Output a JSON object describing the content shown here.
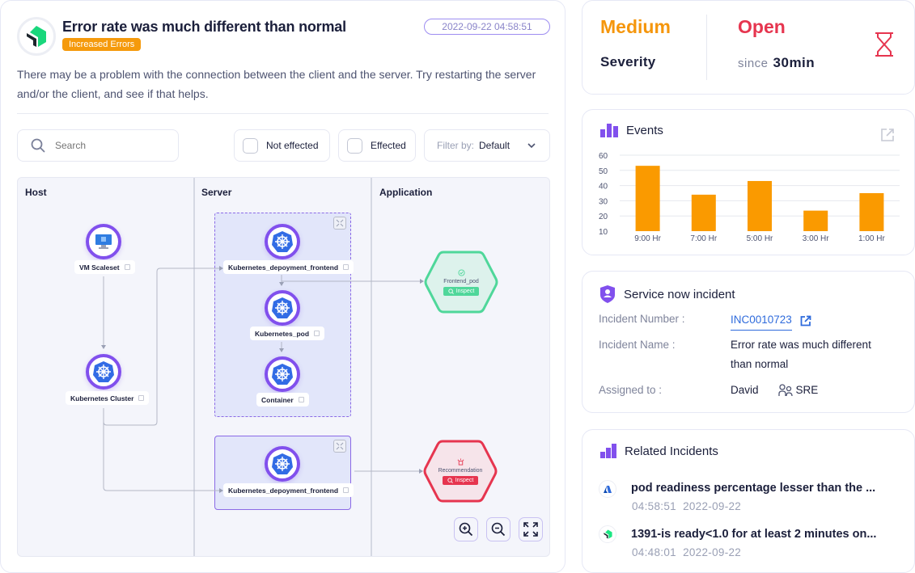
{
  "incident": {
    "title": "Error rate was much different than normal",
    "badge": "Increased Errors",
    "timestamp": "2022-09-22 04:58:51",
    "description": "There may be a problem with the connection between the client and the server. Try restarting the server and/or the client, and see if that helps.",
    "colors": {
      "badge": "#f59a0c",
      "accent": "#8150ed"
    }
  },
  "toolbar": {
    "search_placeholder": "Search",
    "not_effected_label": "Not effected",
    "effected_label": "Effected",
    "filter_label": "Filter by:",
    "filter_value": "Default"
  },
  "topology": {
    "columns": [
      "Host",
      "Server",
      "Application"
    ],
    "nodes": {
      "vm_scaleset": "VM Scaleset",
      "k8s_cluster": "Kubernetes Cluster",
      "k8s_deploy_1": "Kubernetes_depoyment_frontend",
      "k8s_pod": "Kubernetes_pod",
      "container": "Container",
      "k8s_deploy_2": "Kubernetes_depoyment_frontend"
    },
    "apps": [
      {
        "name": "Frontend_pod",
        "status": "healthy",
        "button": "Inspect",
        "color": "#4fd79a"
      },
      {
        "name": "Recommendation",
        "status": "alert",
        "button": "Inspect",
        "color": "#e6354f"
      }
    ],
    "controls": [
      "zoom-in",
      "zoom-out",
      "fit-screen"
    ]
  },
  "severity": {
    "value": "Medium",
    "label": "Severity",
    "status": "Open",
    "since_label": "since",
    "since_value": "30min",
    "colors": {
      "severity": "#f5960c",
      "status": "#e6354f"
    }
  },
  "events": {
    "title": "Events"
  },
  "chart_data": {
    "type": "bar",
    "title": "Events",
    "categories": [
      "9:00 Hr",
      "7:00 Hr",
      "5:00 Hr",
      "3:00 Hr",
      "1:00 Hr"
    ],
    "values": [
      53,
      34,
      43,
      23.5,
      35
    ],
    "ylim": [
      10,
      60
    ],
    "yticks": [
      10,
      20,
      30,
      40,
      50,
      60
    ],
    "xlabel": "",
    "ylabel": "",
    "grid": true,
    "color": "#fa9a00"
  },
  "service_now": {
    "title": "Service now incident",
    "rows": [
      {
        "label": "Incident Number :",
        "value": "INC0010723"
      },
      {
        "label": "Incident Name :",
        "value": "Error rate was much different than normal"
      },
      {
        "label": "Assigned to :",
        "value": "David",
        "team": "SRE"
      }
    ]
  },
  "related": {
    "title": "Related Incidents",
    "items": [
      {
        "source": "azure",
        "title": "pod readiness percentage lesser than the ...",
        "time": "04:58:51",
        "date": "2022-09-22"
      },
      {
        "source": "newrelic",
        "title": "1391-is ready<1.0 for at least 2 minutes on...",
        "time": "04:48:01",
        "date": "2022-09-22"
      }
    ]
  }
}
